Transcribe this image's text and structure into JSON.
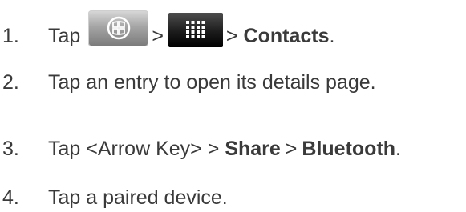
{
  "steps": [
    {
      "number": "1.",
      "text_before": "Tap",
      "sep1": ">",
      "sep2": ">",
      "target": "Contacts",
      "end": ".",
      "icons": [
        "home-key-icon",
        "applications-grid-icon"
      ]
    },
    {
      "number": "2.",
      "text": "Tap an entry to open its details page."
    },
    {
      "number": "3.",
      "text_before": "Tap <Arrow Key> >",
      "bold1": "Share",
      "sep": ">",
      "bold2": "Bluetooth",
      "end": "."
    },
    {
      "number": "4.",
      "text": "Tap a paired device."
    }
  ]
}
